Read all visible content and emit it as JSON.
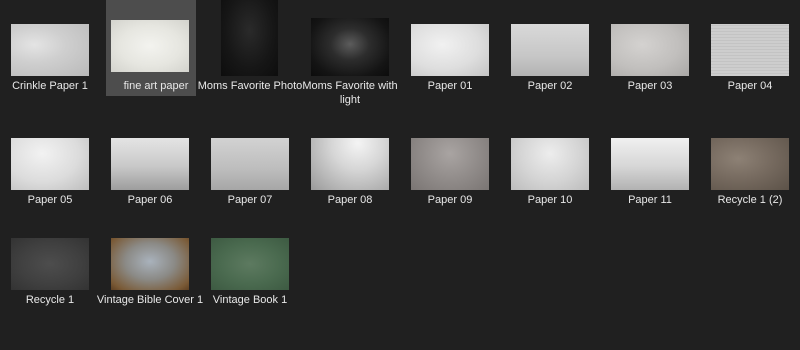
{
  "items": [
    {
      "label": "Crinkle Paper 1",
      "style": "crinkle",
      "selected": false
    },
    {
      "label": "fine art paper",
      "style": "fineart",
      "selected": true
    },
    {
      "label": "Moms Favorite Photo",
      "style": "dark",
      "selected": false
    },
    {
      "label": "Moms Favorite with light",
      "style": "darklight",
      "selected": false
    },
    {
      "label": "Paper 01",
      "style": "p01",
      "selected": false
    },
    {
      "label": "Paper 02",
      "style": "p02",
      "selected": false
    },
    {
      "label": "Paper 03",
      "style": "p03",
      "selected": false
    },
    {
      "label": "Paper 04",
      "style": "p04",
      "selected": false
    },
    {
      "label": "Paper 05",
      "style": "p05",
      "selected": false
    },
    {
      "label": "Paper 06",
      "style": "p06",
      "selected": false
    },
    {
      "label": "Paper 07",
      "style": "p07",
      "selected": false
    },
    {
      "label": "Paper 08",
      "style": "p08",
      "selected": false
    },
    {
      "label": "Paper 09",
      "style": "p09",
      "selected": false
    },
    {
      "label": "Paper 10",
      "style": "p10",
      "selected": false
    },
    {
      "label": "Paper 11",
      "style": "p11",
      "selected": false
    },
    {
      "label": "Recycle 1 (2)",
      "style": "recycle2",
      "selected": false
    },
    {
      "label": "Recycle 1",
      "style": "recycle1",
      "selected": false
    },
    {
      "label": "Vintage Bible Cover 1",
      "style": "bible",
      "selected": false
    },
    {
      "label": "Vintage Book 1",
      "style": "book",
      "selected": false
    }
  ],
  "colors": {
    "background": "#202020",
    "selection": "#4d4d4d",
    "label_text": "#e8e8e8"
  }
}
